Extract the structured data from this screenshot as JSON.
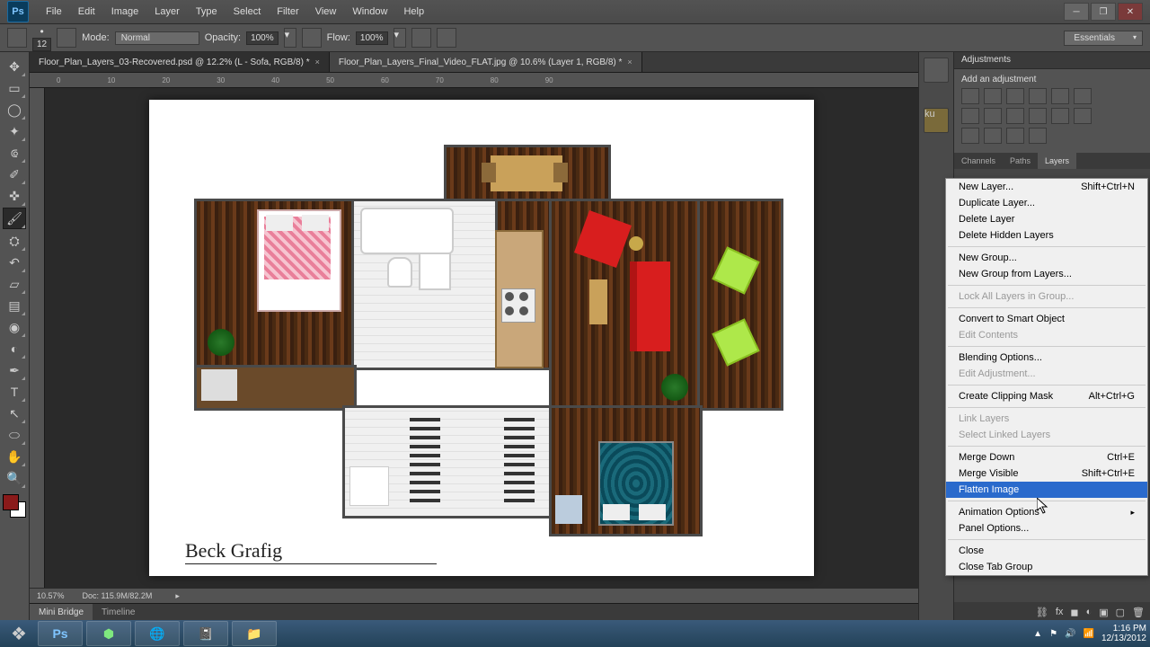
{
  "app_badge": "Ps",
  "menu": [
    "File",
    "Edit",
    "Image",
    "Layer",
    "Type",
    "Select",
    "Filter",
    "View",
    "Window",
    "Help"
  ],
  "options_bar": {
    "brush_size": "12",
    "mode_label": "Mode:",
    "mode_value": "Normal",
    "opacity_label": "Opacity:",
    "opacity_value": "100%",
    "flow_label": "Flow:",
    "flow_value": "100%"
  },
  "workspace": "Essentials",
  "doc_tabs": [
    "Floor_Plan_Layers_03-Recovered.psd @ 12.2% (L - Sofa, RGB/8) *",
    "Floor_Plan_Layers_Final_Video_FLAT.jpg @ 10.6% (Layer 1, RGB/8) *"
  ],
  "active_tab": 1,
  "ruler_h": [
    "0",
    "10",
    "20",
    "30",
    "40",
    "50",
    "60",
    "70",
    "80",
    "90"
  ],
  "signature": "Beck Grafig",
  "status": {
    "zoom": "10.57%",
    "doc": "Doc: 115.9M/82.2M"
  },
  "bottom_tabs": [
    "Mini Bridge",
    "Timeline"
  ],
  "right_panel": {
    "adjustments_title": "Adjustments",
    "add_adjustment_label": "Add an adjustment",
    "layer_tabs": [
      "Channels",
      "Paths",
      "Layers"
    ]
  },
  "context_menu": [
    {
      "label": "New Layer...",
      "shortcut": "Shift+Ctrl+N"
    },
    {
      "label": "Duplicate Layer..."
    },
    {
      "label": "Delete Layer"
    },
    {
      "label": "Delete Hidden Layers"
    },
    {
      "sep": true
    },
    {
      "label": "New Group..."
    },
    {
      "label": "New Group from Layers..."
    },
    {
      "sep": true
    },
    {
      "label": "Lock All Layers in Group...",
      "disabled": true
    },
    {
      "sep": true
    },
    {
      "label": "Convert to Smart Object"
    },
    {
      "label": "Edit Contents",
      "disabled": true
    },
    {
      "sep": true
    },
    {
      "label": "Blending Options..."
    },
    {
      "label": "Edit Adjustment...",
      "disabled": true
    },
    {
      "sep": true
    },
    {
      "label": "Create Clipping Mask",
      "shortcut": "Alt+Ctrl+G"
    },
    {
      "sep": true
    },
    {
      "label": "Link Layers",
      "disabled": true
    },
    {
      "label": "Select Linked Layers",
      "disabled": true
    },
    {
      "sep": true
    },
    {
      "label": "Merge Down",
      "shortcut": "Ctrl+E"
    },
    {
      "label": "Merge Visible",
      "shortcut": "Shift+Ctrl+E"
    },
    {
      "label": "Flatten Image",
      "highlight": true
    },
    {
      "sep": true
    },
    {
      "label": "Animation Options",
      "submenu": true
    },
    {
      "label": "Panel Options..."
    },
    {
      "sep": true
    },
    {
      "label": "Close"
    },
    {
      "label": "Close Tab Group"
    }
  ],
  "tools": [
    "move",
    "marquee",
    "lasso",
    "wand",
    "crop",
    "eyedrop",
    "heal",
    "brush",
    "stamp",
    "history",
    "eraser",
    "gradient",
    "blur",
    "dodge",
    "pen",
    "type",
    "path",
    "rect",
    "hand",
    "zoom"
  ],
  "active_tool": 7,
  "taskbar": {
    "time": "1:16 PM",
    "date": "12/13/2012"
  }
}
